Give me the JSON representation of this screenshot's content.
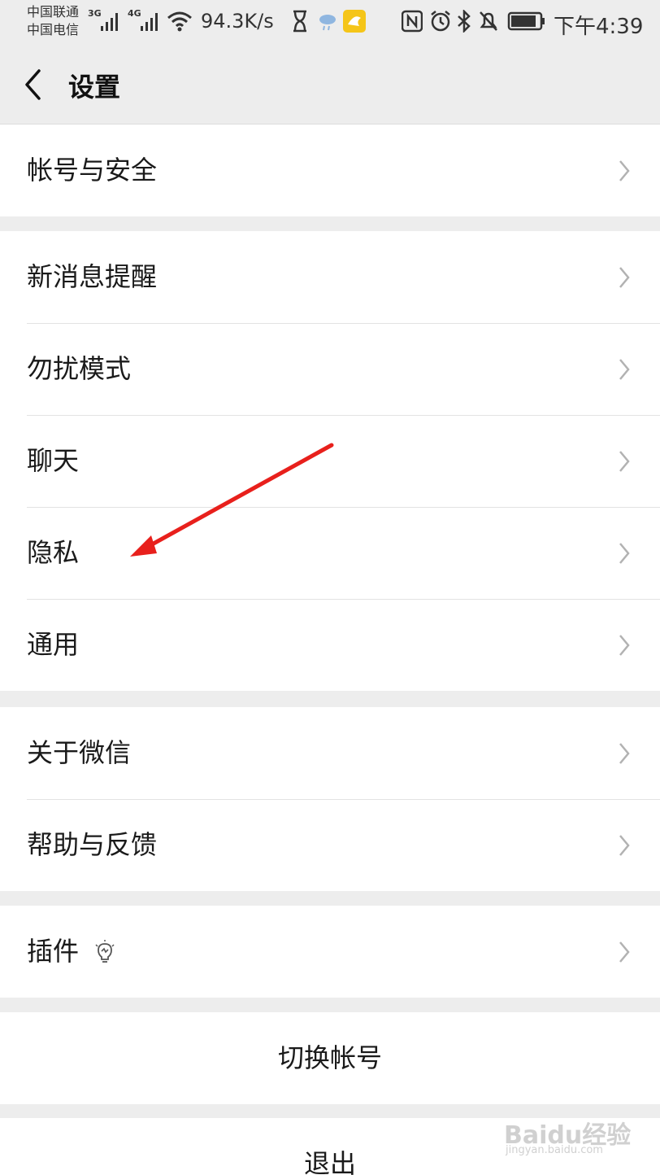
{
  "status_bar": {
    "carrier_1": "中国联通",
    "carrier_2": "中国电信",
    "net_1": "3G",
    "net_2": "4G",
    "speed": "94.3K/s",
    "time": "下午4:39",
    "icons": [
      "signal-icon",
      "wifi-icon",
      "hourglass-icon",
      "weather-icon",
      "app-notification-icon",
      "nfc-icon",
      "alarm-icon",
      "bluetooth-icon",
      "mute-icon",
      "battery-icon"
    ]
  },
  "navbar": {
    "title": "设置"
  },
  "groups": {
    "account": {
      "items": [
        {
          "label": "帐号与安全"
        }
      ]
    },
    "main": {
      "items": [
        {
          "label": "新消息提醒"
        },
        {
          "label": "勿扰模式"
        },
        {
          "label": "聊天"
        },
        {
          "label": "隐私"
        },
        {
          "label": "通用"
        }
      ]
    },
    "about": {
      "items": [
        {
          "label": "关于微信"
        },
        {
          "label": "帮助与反馈"
        }
      ]
    },
    "plugins": {
      "items": [
        {
          "label": "插件"
        }
      ]
    },
    "switch_account": {
      "label": "切换帐号"
    },
    "logout": {
      "label": "退出"
    }
  },
  "watermark": {
    "text": "Baidu经验",
    "url": "jingyan.baidu.com"
  },
  "colors": {
    "background": "#ededed",
    "card": "#ffffff",
    "arrow": "#e8201c",
    "chevron": "#b2b2b2"
  }
}
